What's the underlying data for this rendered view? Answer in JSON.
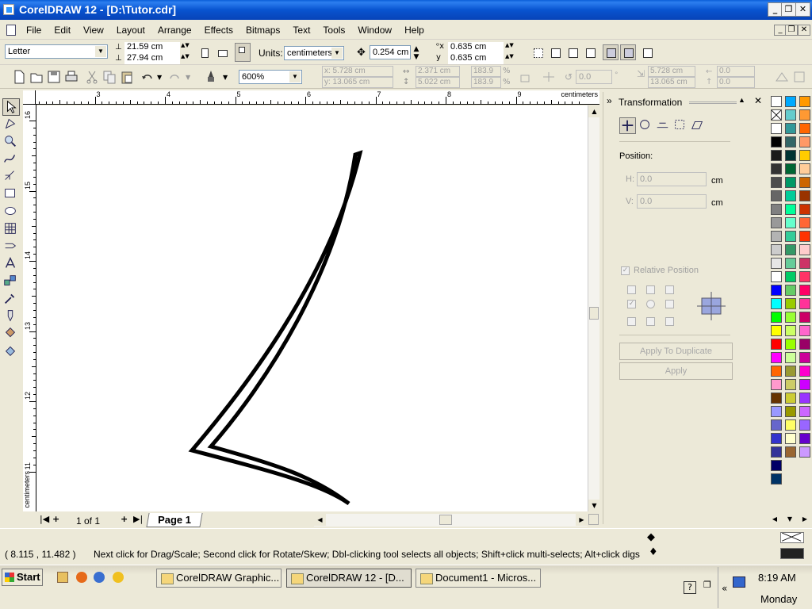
{
  "window": {
    "title": "CorelDRAW 12 - [D:\\Tutor.cdr]"
  },
  "menu": [
    "File",
    "Edit",
    "View",
    "Layout",
    "Arrange",
    "Effects",
    "Bitmaps",
    "Text",
    "Tools",
    "Window",
    "Help"
  ],
  "propbar": {
    "paper": "Letter",
    "width": "21.59 cm",
    "height": "27.94 cm",
    "units_label": "Units:",
    "units": "centimeters",
    "nudge": "0.254 cm",
    "dup_x": "0.635 cm",
    "dup_y": "0.635 cm"
  },
  "stdbar": {
    "zoom": "600%",
    "x": "x: 5.728 cm",
    "y": "y: 13.065 cm",
    "w": "2.371 cm",
    "h": "5.022 cm",
    "sx": "183.9",
    "sy": "183.9",
    "pct": "%",
    "angle": "0.0",
    "cx": "5.728 cm",
    "cy": "13.065 cm",
    "ox": "0.0",
    "oy": "0.0"
  },
  "ruler": {
    "unit": "centimeters",
    "h_ticks": [
      "2",
      "3",
      "4",
      "5",
      "6",
      "7",
      "8",
      "9"
    ],
    "v_ticks": [
      "16",
      "15",
      "14",
      "13",
      "12",
      "11"
    ]
  },
  "pages": {
    "count": "1 of 1",
    "tab": "Page 1"
  },
  "docker": {
    "title": "Transformation",
    "position_label": "Position:",
    "h_label": "H:",
    "h_value": "0.0",
    "v_label": "V:",
    "v_value": "0.0",
    "unit": "cm",
    "relative": "Relative Position",
    "apply_dup": "Apply To Duplicate",
    "apply": "Apply"
  },
  "palette": {
    "left": [
      "#ffffff",
      "#000000",
      "#1a1a1a",
      "#333333",
      "#4d4d4d",
      "#666666",
      "#808080",
      "#999999",
      "#b3b3b3",
      "#cccccc",
      "#e6e6e6",
      "#ffffff",
      "#0000ff",
      "#00ffff",
      "#00ff00",
      "#ffff00",
      "#ff0000",
      "#ff00ff",
      "#ff6600",
      "#ff99cc",
      "#663300",
      "#9999ff",
      "#6666cc",
      "#3333cc",
      "#333399",
      "#000066",
      "#003366"
    ],
    "mid": [
      "#00aaff",
      "#66cccc",
      "#339999",
      "#336666",
      "#003333",
      "#006633",
      "#009966",
      "#00cc99",
      "#00ff99",
      "#66ffcc",
      "#33cc99",
      "#339966",
      "#66cc99",
      "#00cc66",
      "#66cc66",
      "#99cc00",
      "#99ff33",
      "#ccff66",
      "#99ff00",
      "#ccff99",
      "#999933",
      "#cccc66",
      "#cccc33",
      "#999900",
      "#ffff66",
      "#ffffcc",
      "#996633"
    ],
    "right": [
      "#ff9900",
      "#ff9933",
      "#ff6600",
      "#ff9966",
      "#ffcc00",
      "#ffcc99",
      "#cc6600",
      "#993300",
      "#cc3300",
      "#ff6633",
      "#ff3300",
      "#ffcccc",
      "#cc3366",
      "#ff3366",
      "#ff0066",
      "#ff3399",
      "#cc0066",
      "#ff66cc",
      "#990066",
      "#cc0099",
      "#ff00cc",
      "#cc00ff",
      "#9933ff",
      "#cc66ff",
      "#9966ff",
      "#6600cc",
      "#cc99ff"
    ]
  },
  "status": {
    "coords": "( 8.115 , 11.482 )",
    "hint": "Next click for Drag/Scale; Second click for Rotate/Skew; Dbl-clicking tool selects all objects; Shift+click multi-selects; Alt+click digs"
  },
  "taskbar": {
    "start": "Start",
    "tasks": [
      "CorelDRAW Graphic...",
      "CorelDRAW 12 - [D...",
      "Document1 - Micros..."
    ],
    "time": "8:19 AM",
    "day": "Monday"
  }
}
